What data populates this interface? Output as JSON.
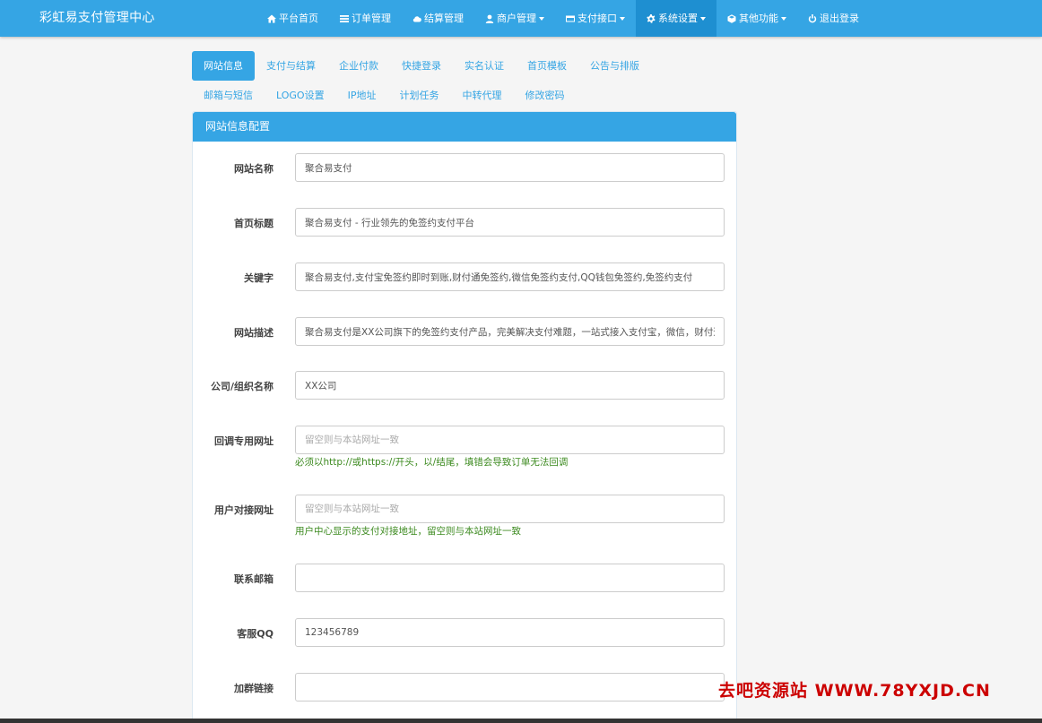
{
  "brand": "彩虹易支付管理中心",
  "nav": [
    {
      "label": "平台首页",
      "icon": "home-icon",
      "dropdown": false,
      "active": false
    },
    {
      "label": "订单管理",
      "icon": "list-icon",
      "dropdown": false,
      "active": false
    },
    {
      "label": "结算管理",
      "icon": "cloud-icon",
      "dropdown": false,
      "active": false
    },
    {
      "label": "商户管理",
      "icon": "user-icon",
      "dropdown": true,
      "active": false
    },
    {
      "label": "支付接口",
      "icon": "credit-card-icon",
      "dropdown": true,
      "active": false
    },
    {
      "label": "系统设置",
      "icon": "gear-icon",
      "dropdown": true,
      "active": true
    },
    {
      "label": "其他功能",
      "icon": "cube-icon",
      "dropdown": true,
      "active": false
    },
    {
      "label": "退出登录",
      "icon": "power-icon",
      "dropdown": false,
      "active": false
    }
  ],
  "tabs_row1": [
    "网站信息",
    "支付与结算",
    "企业付款",
    "快捷登录",
    "实名认证",
    "首页模板",
    "公告与排版"
  ],
  "tabs_row2": [
    "邮箱与短信",
    "LOGO设置",
    "IP地址",
    "计划任务",
    "中转代理",
    "修改密码"
  ],
  "panel": {
    "title": "网站信息配置",
    "fields": [
      {
        "label": "网站名称",
        "value": "聚合易支付",
        "placeholder": ""
      },
      {
        "label": "首页标题",
        "value": "聚合易支付 - 行业领先的免签约支付平台",
        "placeholder": ""
      },
      {
        "label": "关键字",
        "value": "聚合易支付,支付宝免签约即时到账,财付通免签约,微信免签约支付,QQ钱包免签约,免签约支付",
        "placeholder": ""
      },
      {
        "label": "网站描述",
        "value": "聚合易支付是XX公司旗下的免签约支付产品，完美解决支付难题，一站式接入支付宝，微信，财付通，QQ钱包",
        "placeholder": ""
      },
      {
        "label": "公司/组织名称",
        "value": "XX公司",
        "placeholder": ""
      },
      {
        "label": "回调专用网址",
        "value": "",
        "placeholder": "留空则与本站网址一致",
        "help": "必须以http://或https://开头，以/结尾，填错会导致订单无法回调"
      },
      {
        "label": "用户对接网址",
        "value": "",
        "placeholder": "留空则与本站网址一致",
        "help": "用户中心显示的支付对接地址，留空则与本站网址一致"
      },
      {
        "label": "联系邮箱",
        "value": "",
        "placeholder": ""
      },
      {
        "label": "客服QQ",
        "value": "123456789",
        "placeholder": ""
      },
      {
        "label": "加群链接",
        "value": "",
        "placeholder": ""
      }
    ]
  },
  "watermark": "去吧资源站 WWW.78YXJD.CN"
}
